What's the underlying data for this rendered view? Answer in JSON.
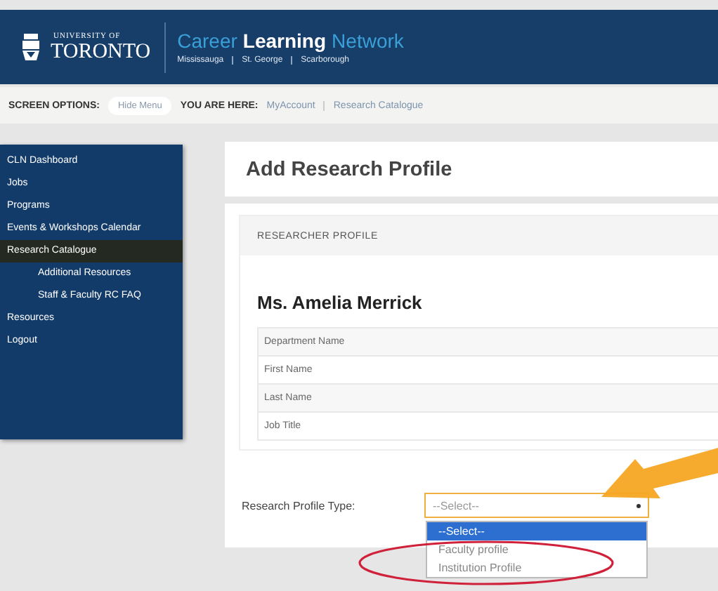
{
  "header": {
    "logo": {
      "small": "UNIVERSITY OF",
      "large": "TORONTO"
    },
    "title": [
      {
        "text": "Career",
        "kind": "accent"
      },
      {
        "text": "Learning",
        "kind": "strong"
      },
      {
        "text": "Network",
        "kind": "accent"
      }
    ],
    "campuses": [
      "Mississauga",
      "St. George",
      "Scarborough"
    ]
  },
  "breadcrumb_bar": {
    "screen_options_label": "SCREEN OPTIONS:",
    "hide_menu_button": "Hide Menu",
    "you_are_here_label": "YOU ARE HERE:",
    "path": [
      "MyAccount",
      "Research Catalogue"
    ]
  },
  "sidebar": {
    "items": [
      {
        "label": "CLN Dashboard",
        "selected": false
      },
      {
        "label": "Jobs",
        "selected": false
      },
      {
        "label": "Programs",
        "selected": false
      },
      {
        "label": "Events & Workshops Calendar",
        "selected": false
      },
      {
        "label": "Research Catalogue",
        "selected": true,
        "children": [
          {
            "label": "Additional Resources",
            "selected": false
          },
          {
            "label": "Staff & Faculty RC FAQ",
            "selected": false
          }
        ]
      },
      {
        "label": "Resources",
        "selected": false
      },
      {
        "label": "Logout",
        "selected": false
      }
    ]
  },
  "page_title": "Add Research Profile",
  "profile_panel": {
    "heading": "RESEARCHER PROFILE",
    "name": "Ms. Amelia Merrick",
    "fields": [
      "Department Name",
      "First Name",
      "Last Name",
      "Job Title"
    ]
  },
  "profile_type": {
    "label": "Research Profile Type:",
    "value": "--Select--",
    "options": [
      {
        "label": "--Select--",
        "selected": true
      },
      {
        "label": "Faculty profile",
        "selected": false
      },
      {
        "label": "Institution Profile",
        "selected": false
      }
    ]
  }
}
